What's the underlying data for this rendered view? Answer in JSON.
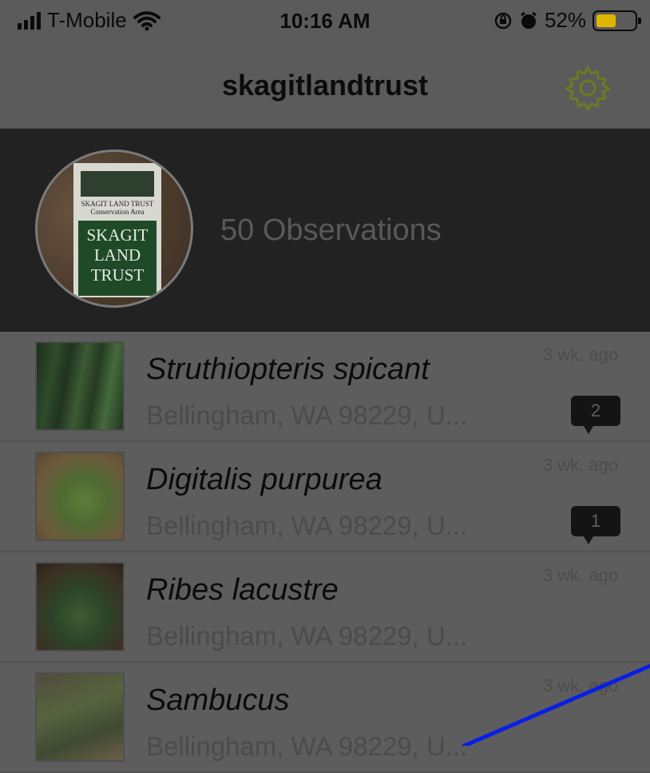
{
  "status_bar": {
    "carrier": "T-Mobile",
    "time": "10:16 AM",
    "battery_percent": "52%",
    "battery_level": 0.52,
    "battery_color": "#e0b500"
  },
  "navbar": {
    "title": "skagitlandtrust",
    "settings_icon": "gear-icon"
  },
  "profile": {
    "observation_count": "50 Observations",
    "avatar_sign": {
      "header_line1": "SKAGIT LAND TRUST",
      "header_line2": "Conservation Area",
      "main_line1": "SKAGIT",
      "main_line2": "LAND",
      "main_line3": "TRUST"
    }
  },
  "observations": [
    {
      "name": "Struthiopteris spicant",
      "place": "Bellingham, WA 98229, U...",
      "time_ago": "3 wk. ago",
      "comments": "2"
    },
    {
      "name": "Digitalis purpurea",
      "place": "Bellingham, WA 98229, U...",
      "time_ago": "3 wk. ago",
      "comments": "1"
    },
    {
      "name": "Ribes lacustre",
      "place": "Bellingham, WA 98229, U...",
      "time_ago": "3 wk. ago",
      "comments": ""
    },
    {
      "name": "Sambucus",
      "place": "Bellingham, WA 98229, U...",
      "time_ago": "3 wk. ago",
      "comments": ""
    }
  ],
  "colors": {
    "overlay_line": "#0a1ee6"
  }
}
